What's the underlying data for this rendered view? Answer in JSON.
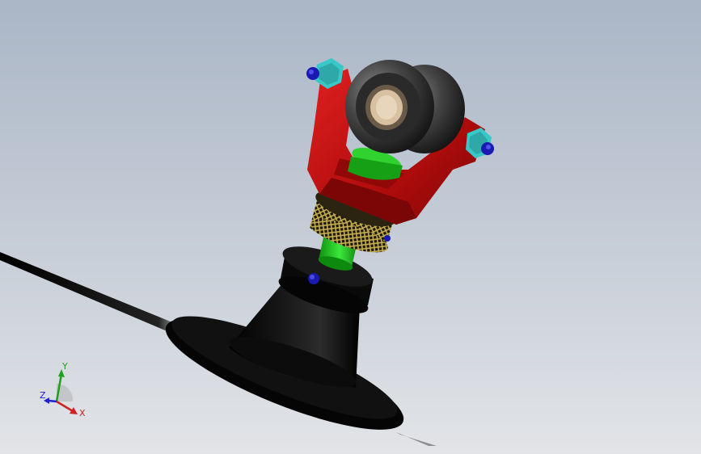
{
  "viewport": {
    "background_top": "#aab6c6",
    "background_bottom": "#e2e4e7"
  },
  "model": {
    "parts": {
      "base_flange": {
        "color": "#050505"
      },
      "cone_body": {
        "color": "#0a0a0a"
      },
      "green_shaft": {
        "color": "#1fd21f"
      },
      "knurled_nut": {
        "color": "#b8a24a"
      },
      "red_yoke": {
        "color": "#c01010"
      },
      "cyan_nuts": {
        "color": "#38c8c8"
      },
      "blue_screws": {
        "color": "#1a1ab0"
      },
      "ball_joint": {
        "color": "#3a3a3a"
      },
      "bronze_bushing": {
        "color": "#d8c0a0"
      }
    }
  },
  "triad": {
    "x_label": "X",
    "y_label": "Y",
    "z_label": "Z",
    "x_color": "#d02020",
    "y_color": "#20a020",
    "z_color": "#2020d0"
  }
}
